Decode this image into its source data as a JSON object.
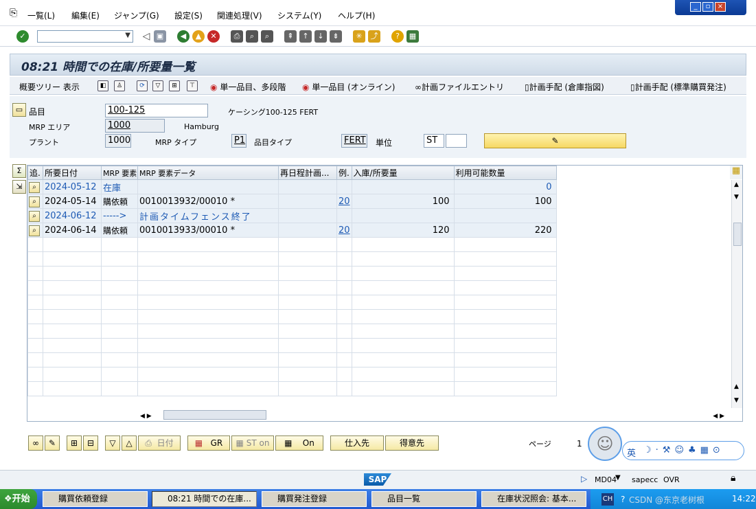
{
  "menu": [
    "一覧(L)",
    "編集(E)",
    "ジャンプ(G)",
    "設定(S)",
    "関連処理(V)",
    "システム(Y)",
    "ヘルプ(H)"
  ],
  "screen_title": "08:21 時間での在庫/所要量一覧",
  "app_toolbar": {
    "overview_tree": "概要ツリー 表示",
    "single_item_multi": "単一品目、多段階",
    "single_item_online": "単一品目 (オンライン)",
    "planning_file_entry": "計画ファイルエントリ",
    "plan_warehouse": "計画手配 (倉庫指図)",
    "plan_standard_purchase": "計画手配 (標準購買発注)"
  },
  "form": {
    "material_label": "品目",
    "material_value": "100-125",
    "material_desc": "ケーシング100-125 FERT",
    "mrp_area_label": "MRP エリア",
    "mrp_area_value": "1000",
    "mrp_area_name": "Hamburg",
    "plant_label": "プラント",
    "plant_value": "1000",
    "mrp_type_label": "MRP タイプ",
    "mrp_type_value": "P1",
    "material_type_label": "品目タイプ",
    "material_type_value": "FERT",
    "unit_label": "単位",
    "unit_value": "ST"
  },
  "grid": {
    "columns": [
      "追.",
      "所要日付",
      "MRP 要素",
      "MRP 要素データ",
      "再日程計画...",
      "例.",
      "入庫/所要量",
      "利用可能数量"
    ],
    "rows": [
      {
        "date": "2024-05-12",
        "element": "在庫",
        "data": "",
        "resched": "",
        "exc": "",
        "qty": "",
        "avail": "0",
        "style": "blue"
      },
      {
        "date": "2024-05-14",
        "element": "購依頼",
        "data": "0010013932/00010 *",
        "resched": "",
        "exc": "20",
        "qty": "100",
        "avail": "100",
        "style": "normal"
      },
      {
        "date": "2024-06-12",
        "element": "----->",
        "data": "計画タイムフェンス終了",
        "resched": "",
        "exc": "",
        "qty": "",
        "avail": "",
        "style": "blue"
      },
      {
        "date": "2024-06-14",
        "element": "購依頼",
        "data": "0010013933/00010 *",
        "resched": "",
        "exc": "20",
        "qty": "120",
        "avail": "220",
        "style": "normal"
      }
    ]
  },
  "bottom_buttons": {
    "date": "日付",
    "gr": "GR",
    "st_on": "ST on",
    "on": "On",
    "vendor": "仕入先",
    "customer": "得意先",
    "page_label": "ページ",
    "page_num": "1"
  },
  "status": {
    "sap": "SAP",
    "tcode": "MD04",
    "server": "sapecc",
    "mode": "OVR"
  },
  "taskbar": {
    "start": "开始",
    "tasks": [
      "購買依頼登録",
      "08:21 時間での在庫...",
      "購買発注登録",
      "品目一覧",
      "在庫状況照会: 基本..."
    ],
    "lang": "CH",
    "time": "14:22",
    "watermark": "CSDN @东京老树根"
  },
  "ime": {
    "label": "英"
  }
}
